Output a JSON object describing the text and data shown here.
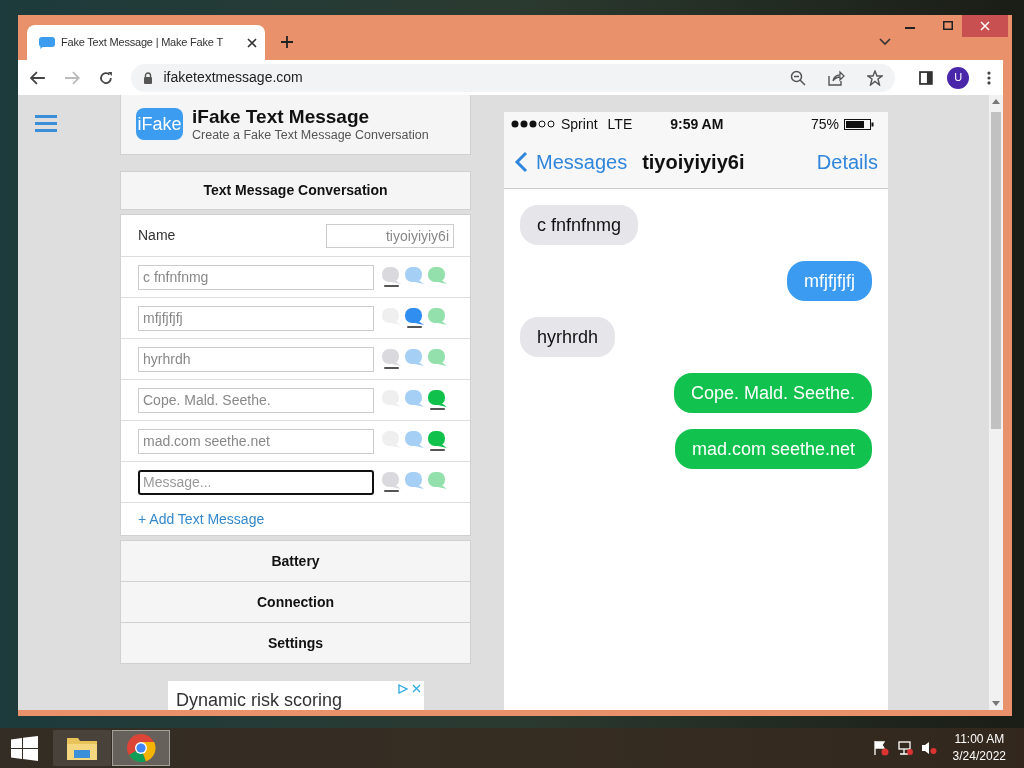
{
  "browser": {
    "tab_title": "Fake Text Message | Make Fake T",
    "url": "ifaketextmessage.com",
    "avatar": "U"
  },
  "header": {
    "logo": "iFake",
    "title": "iFake Text Message",
    "subtitle": "Create a Fake Text Message Conversation"
  },
  "conversation": {
    "heading": "Text Message Conversation",
    "name_label": "Name",
    "name_value": "tiyoiyiyiy6i",
    "messages": [
      {
        "value": "c fnfnfnmg",
        "focused": false,
        "styles": [
          {
            "kind": "gray",
            "selected": true
          },
          {
            "kind": "blue",
            "selected": false
          },
          {
            "kind": "green",
            "selected": false
          }
        ]
      },
      {
        "value": "mfjfjfjfj",
        "focused": false,
        "styles": [
          {
            "kind": "gray",
            "selected": false
          },
          {
            "kind": "blue",
            "selected": true
          },
          {
            "kind": "green",
            "selected": false
          }
        ]
      },
      {
        "value": "hyrhrdh",
        "focused": false,
        "styles": [
          {
            "kind": "gray",
            "selected": true
          },
          {
            "kind": "blue",
            "selected": false
          },
          {
            "kind": "green",
            "selected": false
          }
        ]
      },
      {
        "value": "Cope. Mald. Seethe.",
        "focused": false,
        "styles": [
          {
            "kind": "gray",
            "selected": false
          },
          {
            "kind": "blue",
            "selected": false
          },
          {
            "kind": "green",
            "selected": true
          }
        ]
      },
      {
        "value": "mad.com seethe.net",
        "focused": false,
        "styles": [
          {
            "kind": "gray",
            "selected": false
          },
          {
            "kind": "blue",
            "selected": false
          },
          {
            "kind": "green",
            "selected": true
          }
        ]
      },
      {
        "placeholder": "Message...",
        "focused": true,
        "styles": [
          {
            "kind": "gray",
            "selected": true
          },
          {
            "kind": "blue",
            "selected": false
          },
          {
            "kind": "green",
            "selected": false
          }
        ]
      }
    ],
    "add_link": "+ Add Text Message"
  },
  "sections": [
    "Battery",
    "Connection",
    "Settings"
  ],
  "ad": {
    "text": "Dynamic risk scoring"
  },
  "preview": {
    "carrier": "Sprint",
    "network": "LTE",
    "time": "9:59 AM",
    "battery": "75%",
    "back": "Messages",
    "contact": "tiyoiyiyiy6i",
    "details": "Details",
    "messages": [
      {
        "text": "c fnfnfnmg",
        "kind": "received"
      },
      {
        "text": "mfjfjfjfj",
        "kind": "imessage"
      },
      {
        "text": "hyrhrdh",
        "kind": "received"
      },
      {
        "text": "Cope. Mald. Seethe.",
        "kind": "sms"
      },
      {
        "text": "mad.com seethe.net",
        "kind": "sms"
      }
    ]
  },
  "taskbar": {
    "time": "11:00 AM",
    "date": "3/24/2022"
  }
}
